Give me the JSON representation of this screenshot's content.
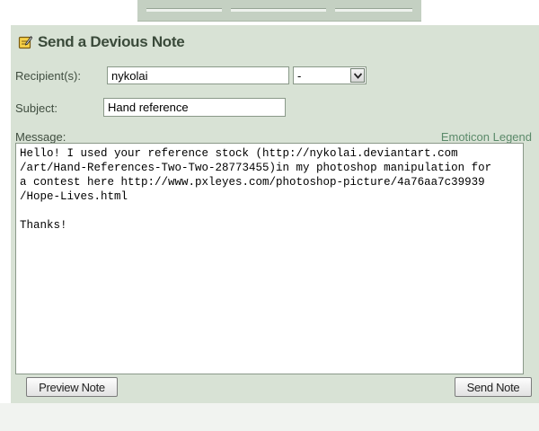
{
  "form": {
    "title": "Send a Devious Note",
    "recipient_label": "Recipient(s):",
    "recipient_value": "nykolai",
    "recipient_select_value": "-",
    "subject_label": "Subject:",
    "subject_value": "Hand reference",
    "message_label": "Message:",
    "emoticon_legend": "Emoticon Legend",
    "message_body": "Hello! I used your reference stock (http://nykolai.deviantart.com\n/art/Hand-References-Two-Two-28773455)in my photoshop manipulation for\na contest here http://www.pxleyes.com/photoshop-picture/4a76aa7c39939\n/Hope-Lives.html\n\nThanks!",
    "preview_button": "Preview Note",
    "send_button": "Send Note"
  },
  "icons": {
    "title_icon": "note-pencil-icon",
    "select_arrow": "chevron-down-icon"
  },
  "colors": {
    "panel_bg": "#d8e2d5",
    "title_text": "#3a4a3a",
    "link": "#5b8a6a"
  }
}
